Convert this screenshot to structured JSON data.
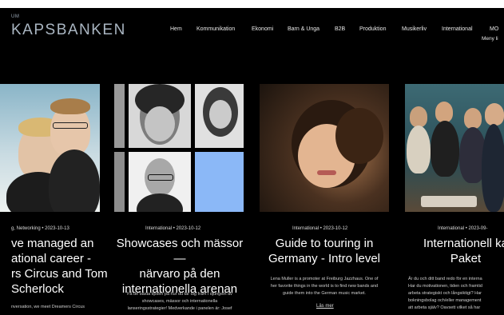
{
  "header": {
    "logo_prefix": "UM",
    "logo": "KAPSBANKEN",
    "nav": [
      "Hem",
      "Kommunikation",
      "Ekonomi",
      "Barn & Unga",
      "B2B",
      "Produktion",
      "Musikerliv",
      "International",
      "MO"
    ],
    "menu_more": "Meny li"
  },
  "cards": [
    {
      "meta": "g, Networking • 2023-10-13",
      "title_lines": [
        "ve managed an",
        "ational career -",
        "rs Circus and Tom",
        "Scherlock"
      ],
      "excerpt_lines": [
        "nversation, we meet Dreamers Circus"
      ]
    },
    {
      "meta": "International • 2023-10-12",
      "title_lines": [
        "Showcases och mässor —",
        "närvaro på den",
        "internationella arenan"
      ],
      "excerpt_lines": [
        "Få de bästa tipsen på hur du tar dig fram i djungeln av",
        "showcases, mässor och internationella",
        "lanseringsstrategier! Medverkande i panelen är: Josef"
      ]
    },
    {
      "meta": "International • 2023-10-12",
      "title_lines": [
        "Guide to touring in",
        "Germany - Intro level"
      ],
      "excerpt_lines": [
        "Lena Muller is a promoter at Freiburg Jazzhaus. One of",
        "her favorite things in the world is to find new bands and",
        "guide them into the German music market."
      ],
      "read_more": "Läs mer"
    },
    {
      "meta": "International • 2023-09-",
      "title_lines": [
        "Internationell ka",
        "Paket"
      ],
      "excerpt_lines": [
        "Är du och ditt band redo för en interna",
        "Har du motivationen, tiden och framtid",
        "arbeta strategiskt och långsiktigt? Har",
        "bokningsbolag och/eller management",
        "att arbeta själv? Oavsett vilket så har"
      ]
    }
  ]
}
